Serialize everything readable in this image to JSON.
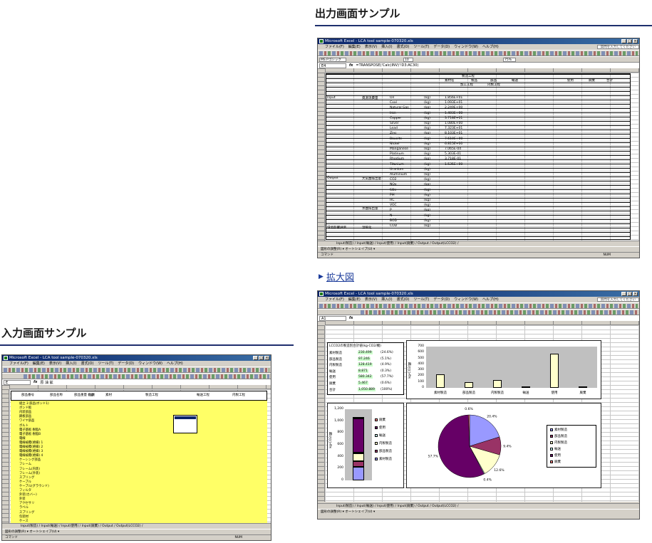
{
  "output_section": {
    "title": "出力画面サンプル",
    "zoom_link": "拡大図"
  },
  "input_section": {
    "title": "入力画面サンプル"
  },
  "excel": {
    "app_title": "Microsoft Excel - LCA tool sample-070320.xls",
    "menu": [
      "ファイル(F)",
      "編集(E)",
      "表示(V)",
      "挿入(I)",
      "書式(O)",
      "ツール(T)",
      "データ(D)",
      "ウィンドウ(W)",
      "ヘルプ(H)"
    ],
    "help_placeholder": "質問を入力してください",
    "status_left": "コマンド",
    "status_num": "NUM",
    "drawing_bar": "図形の調整(R) ▾  オートシェイプ(U) ▾",
    "font_name": "MS Pゴシック",
    "font_size": "10",
    "zoom": "75%"
  },
  "output_window": {
    "cell_ref": "E4",
    "formula": "=TRANSPOSE('Calc(INV)'!D3:AC30)",
    "tabs": "Input(製造) / Input(輸送) / Input(使用) / Input(廃棄) / Output / Output(LCCO2) /",
    "header_cells": [
      "素材名",
      "製造工程",
      "製品",
      "部品",
      "加工工程",
      "内製工程",
      "輸送",
      "使用",
      "廃棄",
      "合計"
    ],
    "row_groups": [
      "Input",
      "Output",
      "環境影響評価"
    ],
    "sub_groups": [
      "資源消費量",
      "大気圏排出量",
      "水圏排出量",
      "温暖化"
    ],
    "substances": [
      "Oil",
      "Coal",
      "Natural Gas",
      "Iron",
      "Copper",
      "Silver",
      "Lead",
      "Zinc",
      "Bauxite",
      "Nickel",
      "Manganese",
      "Platinum",
      "Rhodium",
      "Titanium",
      "Uranium",
      "Aluminium",
      "CO2",
      "NOx",
      "SOx",
      "PM",
      "HC",
      "VOC",
      "P",
      "N",
      "BOD",
      "COD"
    ],
    "units": [
      "(kg)",
      "(kg-CO2eq)",
      "(kg-SO2 eq/kg)"
    ],
    "sample_values": [
      "1.856E+01",
      "1.093E+01",
      "2.249E+00",
      "1.403E+00",
      "3.718E+01",
      "1.080E+00",
      "7.323E+01",
      "8.103E+01",
      "7.610E+00",
      "6.815E+00",
      "7.065E-04",
      "5.303E-01",
      "3.718E-01",
      "1.535E+00"
    ]
  },
  "input_window": {
    "app_title": "Microsoft Excel - LCA tool sample-070320.xls",
    "cell_ref": "E",
    "formula": "原 油 鉱",
    "header": [
      "部品番号",
      "部品名称",
      "部品重量 (kg)",
      "個数",
      "素材",
      "製造工程",
      "輸送工程",
      "内製工程"
    ],
    "parts": [
      "組立 3 部品(ボンド1)",
      "ボンド板",
      "内装部品",
      "鋼板部品",
      "ワイヤ部品",
      "ボルト",
      "電子基板 樹脂A",
      "電子基板 樹脂B",
      "電線",
      "電線被覆(絶縁) 1",
      "電線被覆(絶縁) 2",
      "電線被覆(絶縁) 3",
      "電線被覆(絶縁) 4",
      "ケーシング部品",
      "フレーム",
      "フレーム(内装)",
      "フレーム(外装)",
      "スプリング",
      "ケーブル",
      "ケーブル(グラウンド)",
      "フィルタ",
      "外装(カバー)",
      "外装",
      "アクセサリ",
      "ラベル",
      "スプリング",
      "包装材",
      "ケース"
    ],
    "tabs": "Input(製造) / Input(輸送) / Input(使用) / Input(廃棄) / Output / Output(LCCO2) /"
  },
  "chart_window": {
    "cell_ref": "A1",
    "summary_title": "LCCO2の製造別合計値(kg-CO2/機)",
    "summary_rows": [
      {
        "label": "素材製造",
        "value": "230.499",
        "pct": "(24.6%)"
      },
      {
        "label": "部品製造",
        "value": "97.246",
        "pct": "(5.1%)"
      },
      {
        "label": "内製製造",
        "value": "128.419",
        "pct": "(4.9%)"
      },
      {
        "label": "輸送",
        "value": "8.871",
        "pct": "(0.3%)"
      },
      {
        "label": "使用",
        "value": "580.342",
        "pct": "(57.7%)"
      },
      {
        "label": "廃棄",
        "value": "5.467",
        "pct": "(0.6%)"
      },
      {
        "label": "合計",
        "value": "1,050.889",
        "pct": "(100%)"
      }
    ],
    "tabs": "Input(製造) / Input(輸送) / Input(使用) / Input(廃棄) / Output / Output(LCCO2) /"
  },
  "chart_data": [
    {
      "type": "bar",
      "title": "",
      "ylabel": "kg-CO2/機",
      "ylim": [
        0,
        700
      ],
      "yticks": [
        0,
        100,
        200,
        300,
        400,
        500,
        600,
        700
      ],
      "categories": [
        "素材製造",
        "部品製造",
        "内製製造",
        "輸送",
        "使用",
        "廃棄"
      ],
      "values": [
        230.5,
        97.2,
        128.4,
        8.9,
        580.3,
        5.5
      ],
      "colors": [
        "#ffffcc",
        "#ffffcc",
        "#ffffcc",
        "#ffffcc",
        "#ffffcc",
        "#ffffcc"
      ]
    },
    {
      "type": "bar",
      "stacked": true,
      "ylabel": "kg-CO2/機",
      "ylim": [
        0,
        1200
      ],
      "yticks": [
        0,
        200,
        400,
        600,
        800,
        1000,
        1200
      ],
      "categories": [
        ""
      ],
      "series": [
        {
          "name": "素材製造",
          "values": [
            230.5
          ],
          "color": "#9999ff"
        },
        {
          "name": "部品製造",
          "values": [
            97.2
          ],
          "color": "#993366"
        },
        {
          "name": "内製製造",
          "values": [
            128.4
          ],
          "color": "#ffffcc"
        },
        {
          "name": "輸送",
          "values": [
            8.9
          ],
          "color": "#ccffff"
        },
        {
          "name": "使用",
          "values": [
            580.3
          ],
          "color": "#660066"
        },
        {
          "name": "廃棄",
          "values": [
            5.5
          ],
          "color": "#ff8080"
        }
      ]
    },
    {
      "type": "pie",
      "categories": [
        "素材製造",
        "部品製造",
        "内製製造",
        "輸送",
        "使用",
        "廃棄"
      ],
      "values": [
        20.4,
        9.4,
        12.6,
        0.4,
        57.7,
        0.6
      ],
      "labels": [
        "20.4%",
        "9.4%",
        "12.6%",
        "0.4%",
        "57.7%",
        "0.6%"
      ],
      "colors": [
        "#9999ff",
        "#993366",
        "#ffffcc",
        "#ccffff",
        "#660066",
        "#ff8080"
      ]
    }
  ]
}
